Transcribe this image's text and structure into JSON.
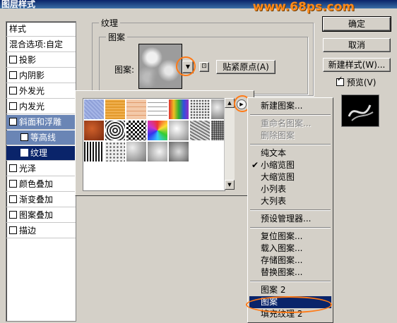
{
  "window": {
    "title": "图层样式",
    "watermark": "www.68ps.com"
  },
  "style_list": {
    "header": "样式",
    "blend_options": "混合选项:自定",
    "items": [
      {
        "label": "投影",
        "checked": false
      },
      {
        "label": "内阴影",
        "checked": false
      },
      {
        "label": "外发光",
        "checked": false
      },
      {
        "label": "内发光",
        "checked": false
      },
      {
        "label": "斜面和浮雕",
        "checked": true
      },
      {
        "label": "等高线",
        "checked": false
      },
      {
        "label": "纹理",
        "checked": true
      },
      {
        "label": "光泽",
        "checked": false
      },
      {
        "label": "颜色叠加",
        "checked": false
      },
      {
        "label": "渐变叠加",
        "checked": false
      },
      {
        "label": "图案叠加",
        "checked": false
      },
      {
        "label": "描边",
        "checked": false
      }
    ]
  },
  "texture_panel": {
    "group_title": "纹理",
    "sub_group_title": "图案",
    "pattern_label": "图案:",
    "snap_origin_button": "贴紧原点(A)",
    "dropdown_icon": "triangle-down-icon",
    "new_preset_icon": "new-preset-icon"
  },
  "buttons": {
    "ok": "确定",
    "cancel": "取消",
    "new_style": "新建样式(W)...",
    "preview_label": "预览(V)",
    "preview_checked": true
  },
  "picker": {
    "menu_arrow_icon": "circle-arrow-right-icon",
    "patterns": [
      "blue-fabric",
      "orange-fabric",
      "peach-tiles",
      "grid",
      "rainbow",
      "speckle",
      "gray-texture",
      "rust",
      "concentric",
      "checker",
      "multicolor",
      "clouds",
      "waves",
      "granite",
      "stripes",
      "dots",
      "marble",
      "marble-2",
      "marble-3"
    ]
  },
  "menu": {
    "items": [
      {
        "label": "新建图案...",
        "disabled": false
      },
      {
        "sep": true
      },
      {
        "label": "重命名图案...",
        "disabled": true
      },
      {
        "label": "删除图案",
        "disabled": true
      },
      {
        "sep": true
      },
      {
        "label": "纯文本",
        "disabled": false
      },
      {
        "label": "小缩览图",
        "disabled": false,
        "checked": true
      },
      {
        "label": "大缩览图",
        "disabled": false
      },
      {
        "label": "小列表",
        "disabled": false
      },
      {
        "label": "大列表",
        "disabled": false
      },
      {
        "sep": true
      },
      {
        "label": "预设管理器...",
        "disabled": false
      },
      {
        "sep": true
      },
      {
        "label": "复位图案...",
        "disabled": false
      },
      {
        "label": "载入图案...",
        "disabled": false
      },
      {
        "label": "存储图案...",
        "disabled": false
      },
      {
        "label": "替换图案...",
        "disabled": false
      },
      {
        "sep": true
      },
      {
        "label": "图案 2",
        "disabled": false
      },
      {
        "label": "图案",
        "disabled": false,
        "selected": true
      },
      {
        "label": "填充纹理 2",
        "disabled": false
      }
    ]
  },
  "colors": {
    "highlight": "#0a246a",
    "accent_ring": "#ff7a16",
    "face": "#d4d0c8"
  }
}
